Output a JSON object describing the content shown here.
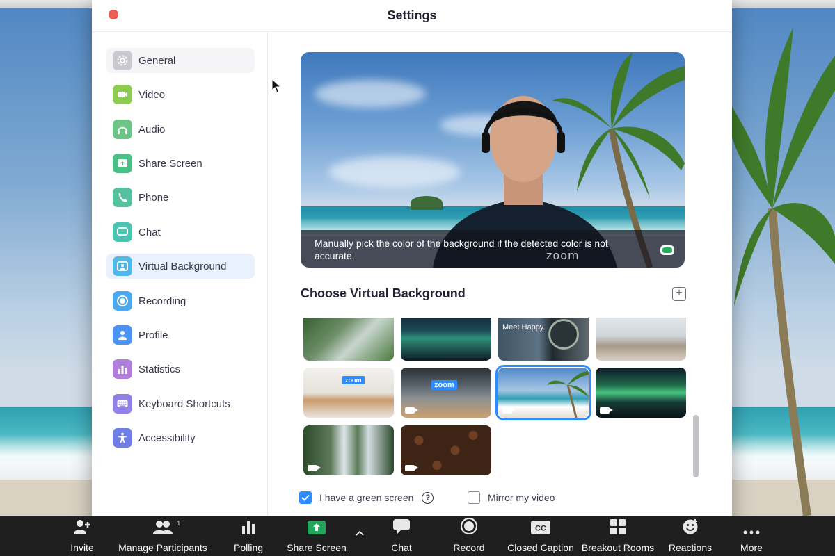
{
  "dialog": {
    "title": "Settings"
  },
  "sidebar": {
    "items": [
      {
        "label": "General",
        "icon": "gear-icon",
        "color": "#c9c9cf",
        "state": "hover"
      },
      {
        "label": "Video",
        "icon": "video-camera-icon",
        "color": "#8dcb51",
        "state": ""
      },
      {
        "label": "Audio",
        "icon": "headphones-icon",
        "color": "#6cc486",
        "state": ""
      },
      {
        "label": "Share Screen",
        "icon": "share-screen-icon",
        "color": "#4cbf86",
        "state": ""
      },
      {
        "label": "Phone",
        "icon": "phone-icon",
        "color": "#55c19f",
        "state": ""
      },
      {
        "label": "Chat",
        "icon": "chat-bubble-icon",
        "color": "#4cc4b3",
        "state": ""
      },
      {
        "label": "Virtual Background",
        "icon": "virtual-background-icon",
        "color": "#52b6e8",
        "state": "selected"
      },
      {
        "label": "Recording",
        "icon": "record-icon",
        "color": "#4aa9ef",
        "state": ""
      },
      {
        "label": "Profile",
        "icon": "profile-icon",
        "color": "#4b94f2",
        "state": ""
      },
      {
        "label": "Statistics",
        "icon": "statistics-icon",
        "color": "#b07fdc",
        "state": ""
      },
      {
        "label": "Keyboard Shortcuts",
        "icon": "keyboard-icon",
        "color": "#8f82e4",
        "state": ""
      },
      {
        "label": "Accessibility",
        "icon": "accessibility-icon",
        "color": "#6f7fe6",
        "state": ""
      }
    ]
  },
  "preview": {
    "caption": "Manually pick the color of the background if the detected color is not accurate.",
    "watermark": "zoom"
  },
  "virtual_background": {
    "heading": "Choose Virtual Background",
    "thumbnails": [
      {
        "name": "greenhouse-plants",
        "selected": false
      },
      {
        "name": "aurora-night-lake",
        "selected": false
      },
      {
        "name": "meet-happy-office",
        "selected": false
      },
      {
        "name": "modern-office-lounge",
        "selected": false
      },
      {
        "name": "zoom-reception-desk",
        "selected": false
      },
      {
        "name": "zoom-office-entrance",
        "selected": false
      },
      {
        "name": "tropical-beach",
        "selected": true
      },
      {
        "name": "green-aurora-forest",
        "selected": false
      },
      {
        "name": "waterfall",
        "selected": false
      },
      {
        "name": "coffee-beans",
        "selected": false
      }
    ],
    "thumb_text": {
      "meet_happy": "Meet Happy.",
      "zoom_sign": "zoom"
    }
  },
  "options": {
    "green_screen": {
      "label": "I have a green screen",
      "checked": true,
      "help": "?"
    },
    "mirror": {
      "label": "Mirror my video",
      "checked": false
    }
  },
  "toolbar": {
    "items": [
      {
        "label": "Invite",
        "icon": "add-user-icon"
      },
      {
        "label": "Manage Participants",
        "icon": "participants-icon",
        "badge": "1"
      },
      {
        "label": "Polling",
        "icon": "polling-icon"
      },
      {
        "label": "Share Screen",
        "icon": "share-screen-icon"
      },
      {
        "label": "Chat",
        "icon": "chat-bubble-icon"
      },
      {
        "label": "Record",
        "icon": "record-icon"
      },
      {
        "label": "Closed Caption",
        "icon": "closed-caption-icon",
        "icon_text": "CC"
      },
      {
        "label": "Breakout Rooms",
        "icon": "breakout-rooms-icon"
      },
      {
        "label": "Reactions",
        "icon": "reactions-icon"
      },
      {
        "label": "More",
        "icon": "more-dots-icon"
      }
    ]
  },
  "colors": {
    "accent": "#2d8cff",
    "close_button": "#ee5f57",
    "share_screen_green": "#23a55a",
    "toolbar_bg": "#1f1f1f"
  }
}
